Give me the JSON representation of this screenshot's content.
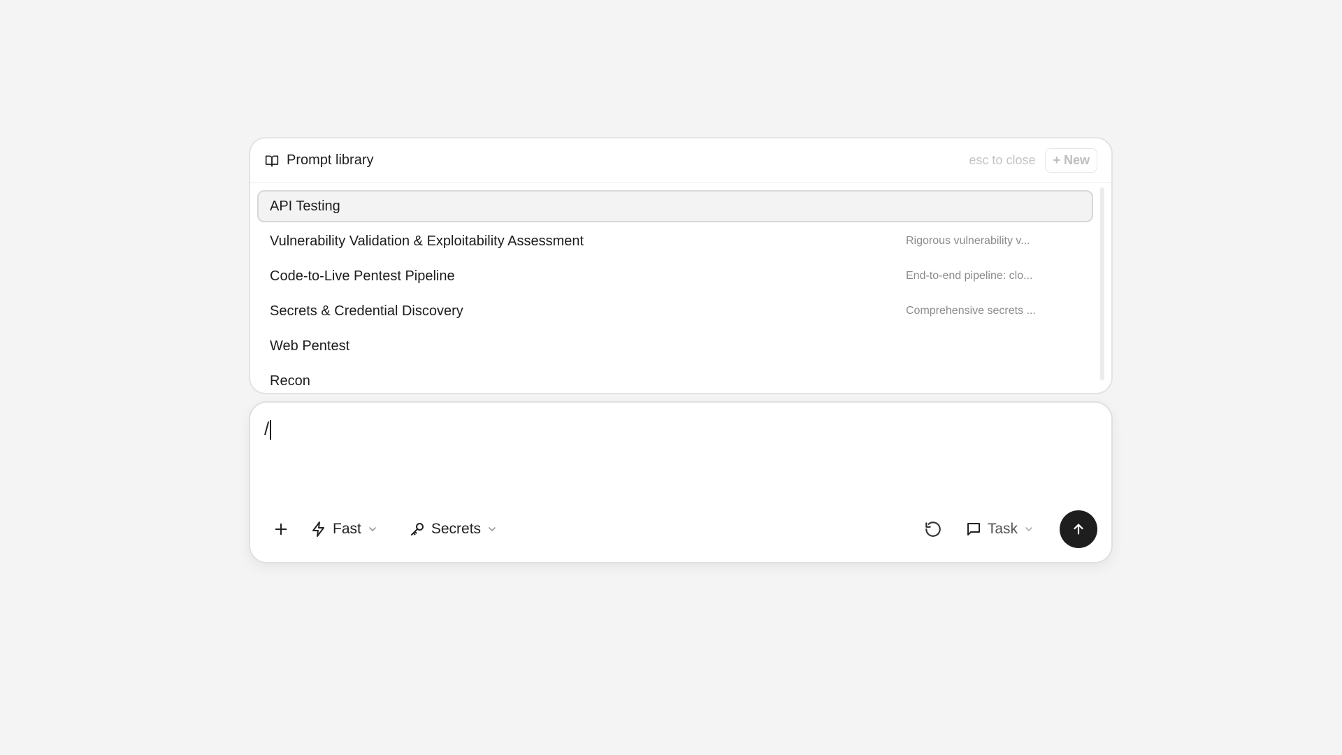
{
  "library": {
    "title": "Prompt library",
    "hint": "esc to close",
    "new_label": "+ New",
    "items": [
      {
        "name": "API Testing",
        "desc": ""
      },
      {
        "name": "Vulnerability Validation & Exploitability Assessment",
        "desc": "Rigorous vulnerability v..."
      },
      {
        "name": "Code-to-Live Pentest Pipeline",
        "desc": "End-to-end pipeline: clo..."
      },
      {
        "name": "Secrets & Credential Discovery",
        "desc": "Comprehensive secrets ..."
      },
      {
        "name": "Web Pentest",
        "desc": ""
      },
      {
        "name": "Recon",
        "desc": ""
      }
    ]
  },
  "composer": {
    "input_value": "/",
    "mode_label": "Fast",
    "secrets_label": "Secrets",
    "task_label": "Task"
  },
  "icons": {
    "library": "book-open-icon",
    "add": "plus-icon",
    "mode": "lightning-bolt-icon",
    "secrets": "key-icon",
    "reset": "rotate-ccw-icon",
    "task": "message-square-icon",
    "send": "arrow-up-icon"
  },
  "colors": {
    "send_button": "#1e1e1e",
    "selected_item_bg": "#f3f3f3"
  }
}
